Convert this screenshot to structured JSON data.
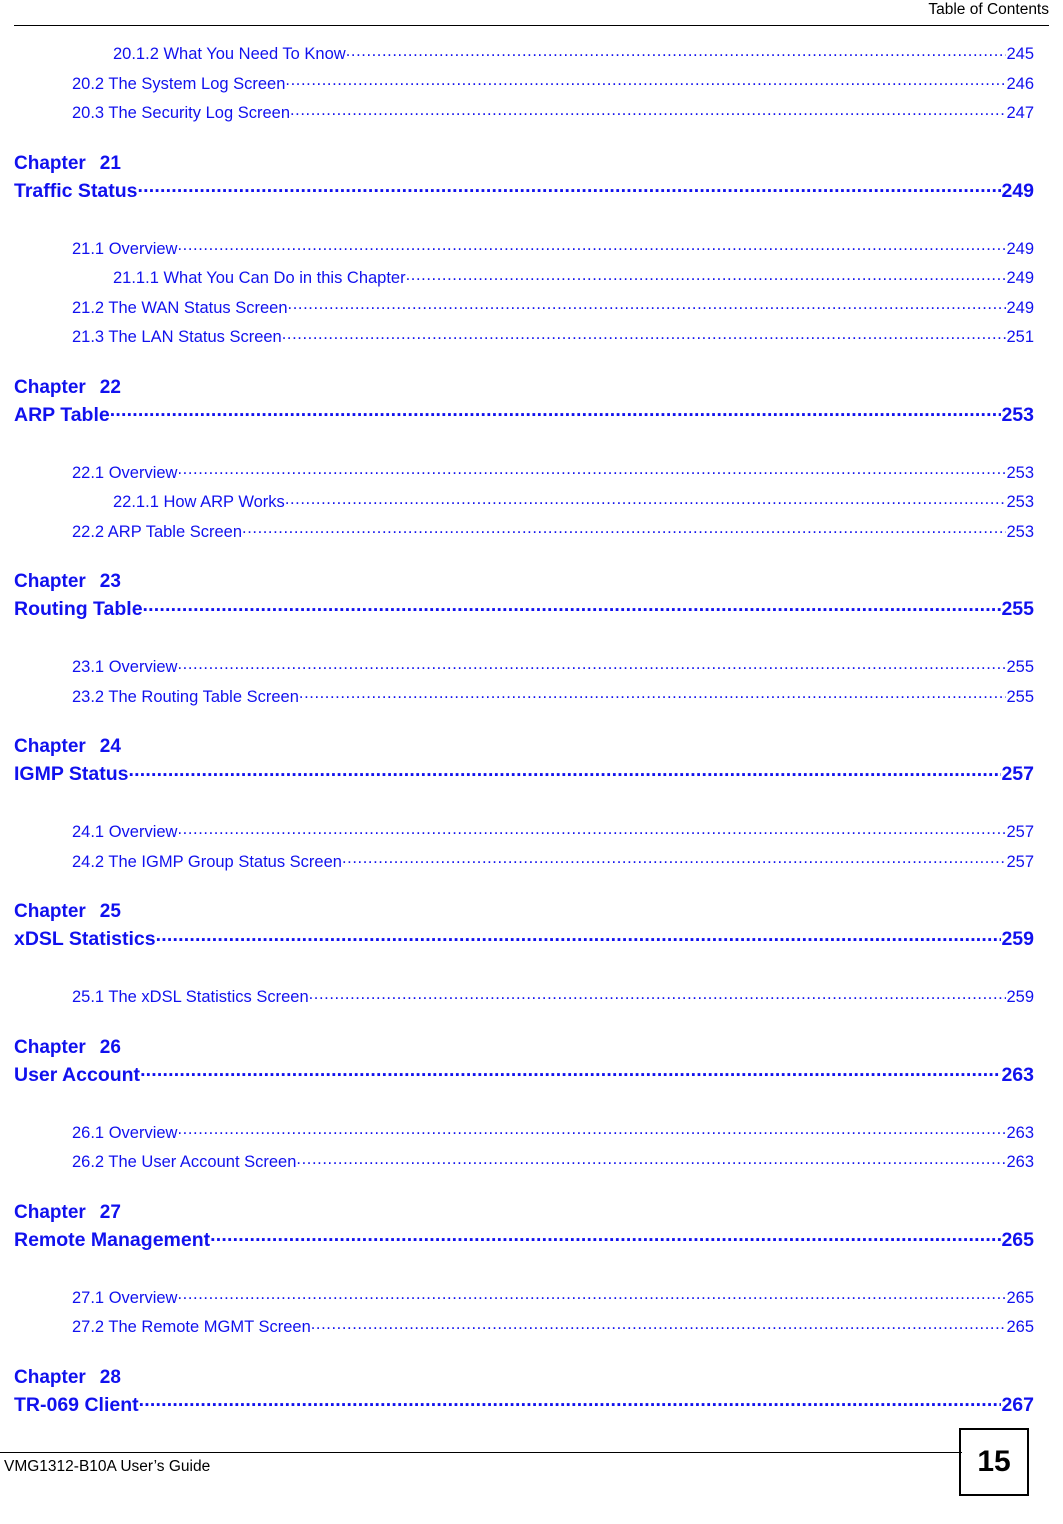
{
  "header": {
    "title": "Table of Contents"
  },
  "footer": {
    "guide_title": "VMG1312-B10A User’s Guide",
    "page_number": "15"
  },
  "colors": {
    "link_blue": "#1111ee",
    "text_black": "#000000",
    "background": "#ffffff"
  },
  "toc": {
    "leading_entries": [
      {
        "level": 3,
        "title": "20.1.2 What You Need To Know ",
        "page": "245"
      },
      {
        "level": 2,
        "title": "20.2 The System Log Screen ",
        "page": "246"
      },
      {
        "level": 2,
        "title": "20.3 The Security Log Screen ",
        "page": "247"
      }
    ],
    "chapters": [
      {
        "chapter_word": "Chapter",
        "chapter_number": "21",
        "title": "Traffic Status ",
        "page": "249",
        "entries": [
          {
            "level": 2,
            "title": "21.1 Overview ",
            "page": "249"
          },
          {
            "level": 3,
            "title": "21.1.1 What You Can Do in this Chapter ",
            "page": "249"
          },
          {
            "level": 2,
            "title": "21.2 The WAN Status Screen ",
            "page": "249"
          },
          {
            "level": 2,
            "title": "21.3 The LAN Status Screen ",
            "page": "251"
          }
        ]
      },
      {
        "chapter_word": "Chapter",
        "chapter_number": "22",
        "title": "ARP Table",
        "page": "253",
        "entries": [
          {
            "level": 2,
            "title": "22.1 Overview ",
            "page": "253"
          },
          {
            "level": 3,
            "title": "22.1.1 How ARP Works ",
            "page": "253"
          },
          {
            "level": 2,
            "title": "22.2 ARP Table Screen ",
            "page": "253"
          }
        ]
      },
      {
        "chapter_word": "Chapter",
        "chapter_number": "23",
        "title": "Routing Table",
        "page": "255",
        "entries": [
          {
            "level": 2,
            "title": "23.1 Overview ",
            "page": "255"
          },
          {
            "level": 2,
            "title": "23.2 The Routing Table Screen ",
            "page": "255"
          }
        ]
      },
      {
        "chapter_word": "Chapter",
        "chapter_number": "24",
        "title": "IGMP Status ",
        "page": "257",
        "entries": [
          {
            "level": 2,
            "title": "24.1 Overview ",
            "page": "257"
          },
          {
            "level": 2,
            "title": "24.2 The IGMP Group Status Screen ",
            "page": "257"
          }
        ]
      },
      {
        "chapter_word": "Chapter",
        "chapter_number": "25",
        "title": "xDSL Statistics",
        "page": "259",
        "entries": [
          {
            "level": 2,
            "title": "25.1 The xDSL Statistics Screen ",
            "page": "259"
          }
        ]
      },
      {
        "chapter_word": "Chapter",
        "chapter_number": "26",
        "title": "User Account ",
        "page": "263",
        "entries": [
          {
            "level": 2,
            "title": "26.1 Overview  ",
            "page": "263"
          },
          {
            "level": 2,
            "title": "26.2 The User Account Screen ",
            "page": "263"
          }
        ]
      },
      {
        "chapter_word": "Chapter",
        "chapter_number": "27",
        "title": "Remote Management",
        "page": "265",
        "entries": [
          {
            "level": 2,
            "title": "27.1 Overview ",
            "page": "265"
          },
          {
            "level": 2,
            "title": "27.2 The Remote MGMT Screen ",
            "page": "265"
          }
        ]
      },
      {
        "chapter_word": "Chapter",
        "chapter_number": "28",
        "title": "TR-069 Client",
        "page": "267",
        "entries": []
      }
    ]
  }
}
